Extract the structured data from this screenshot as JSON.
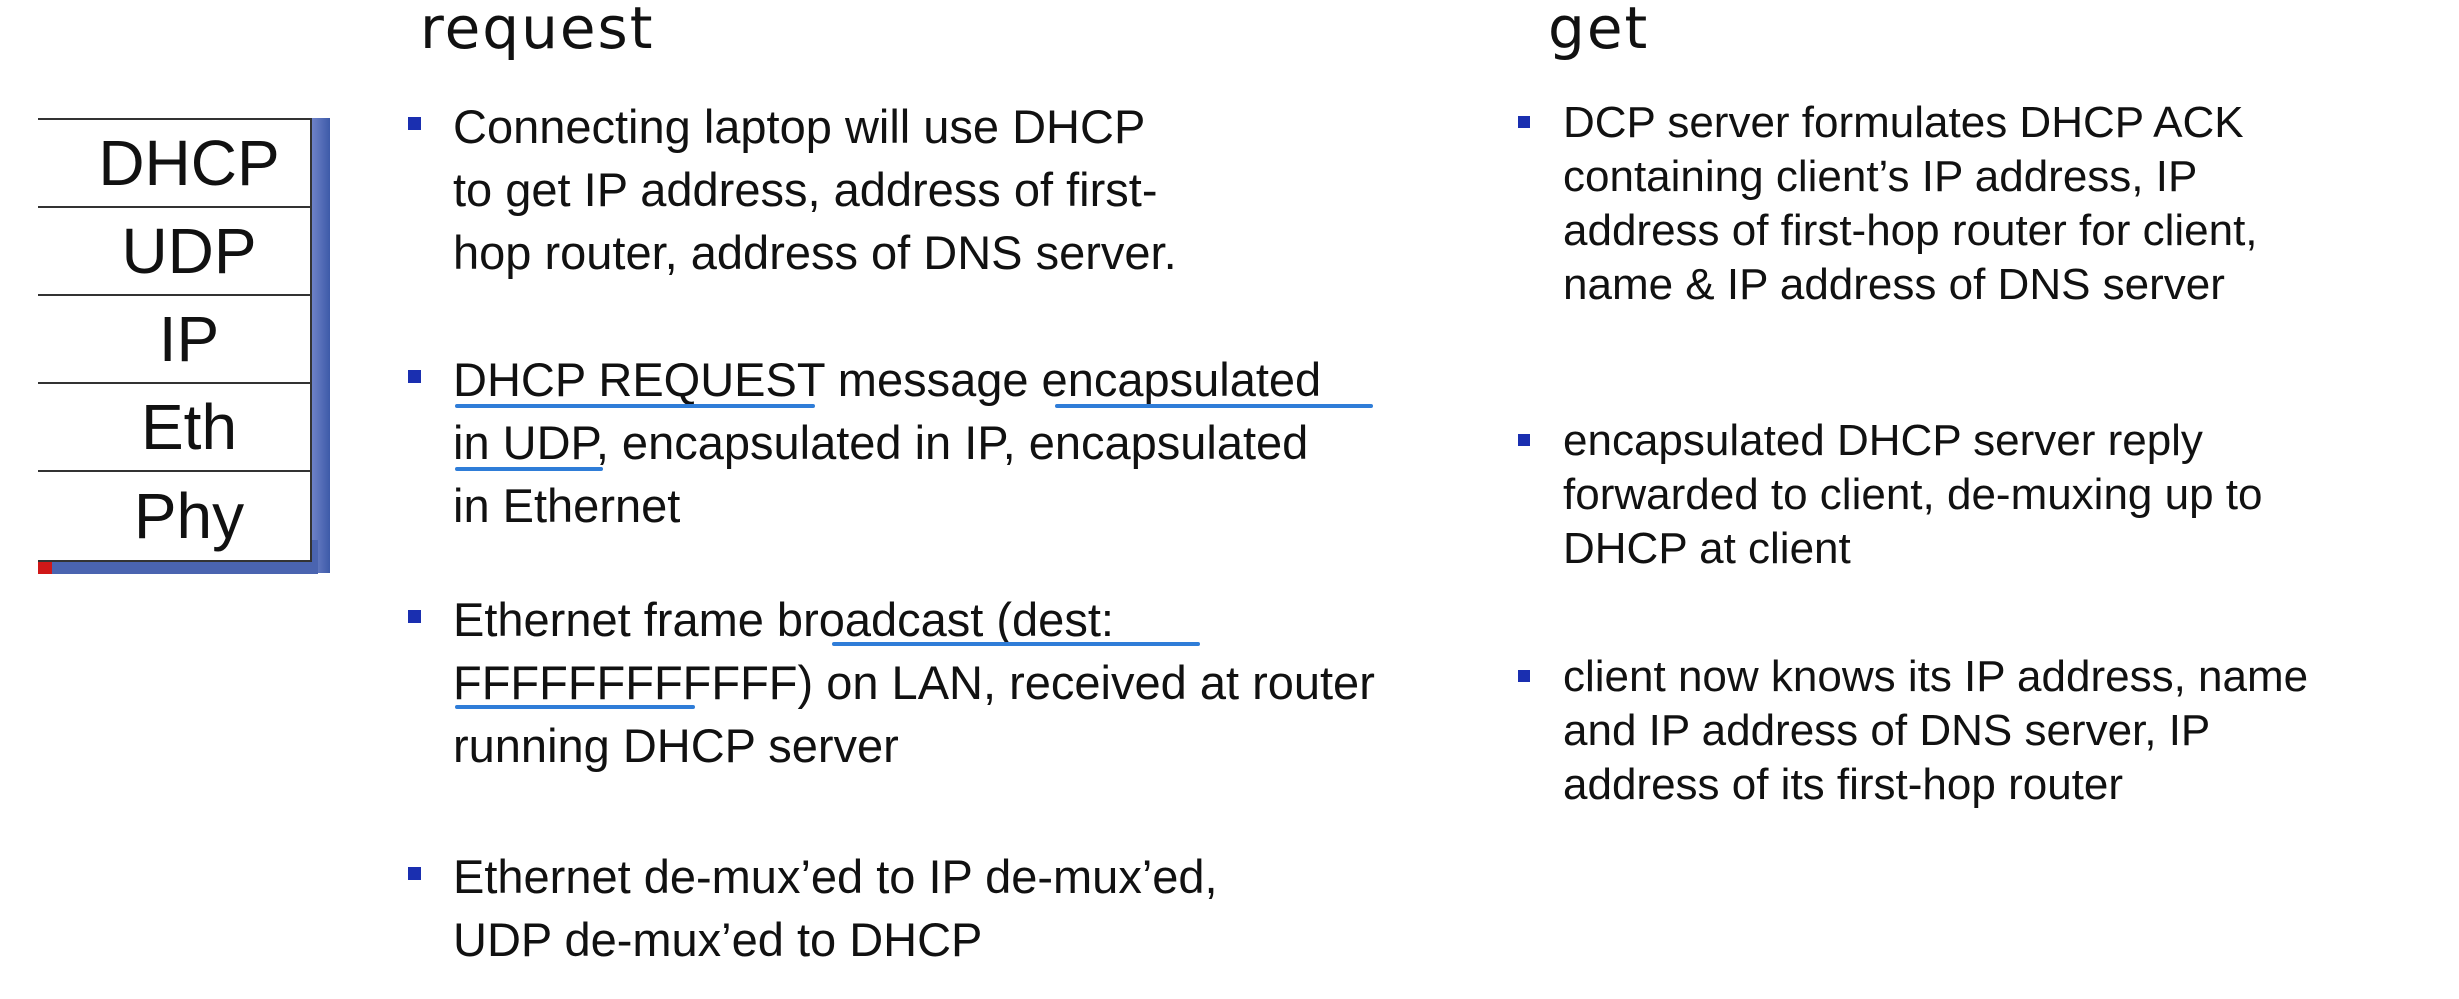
{
  "headings": {
    "left": "request",
    "right": "get"
  },
  "stack": {
    "layers": [
      "DHCP",
      "UDP",
      "IP",
      "Eth",
      "Phy"
    ]
  },
  "left_bullets": [
    {
      "text": "Connecting laptop will use DHCP\nto get IP address, address of first-\nhop router, address of DNS server."
    },
    {
      "text": "DHCP REQUEST message encapsulated\nin UDP, encapsulated in IP, encapsulated\nin Ethernet"
    },
    {
      "text": "Ethernet frame broadcast (dest:\nFFFFFFFFFFFF) on LAN, received at router\nrunning DHCP server"
    },
    {
      "text": "Ethernet de-mux’ed to IP de-mux’ed,\nUDP de-mux’ed to DHCP"
    }
  ],
  "right_bullets": [
    {
      "text": "DCP server formulates DHCP ACK\ncontaining client’s IP address, IP\naddress of first-hop router for client,\nname & IP address of DNS server"
    },
    {
      "text": "encapsulated DHCP server reply\nforwarded to client, de-muxing up to\nDHCP at client"
    },
    {
      "text": "client now knows its IP address, name\nand IP address of DNS server, IP\naddress of its first-hop router"
    }
  ],
  "colors": {
    "bullet": "#1a2fb0",
    "underline": "#2f7dd8",
    "stack_side": "#4a64b0",
    "stack_accent": "#d01818"
  }
}
